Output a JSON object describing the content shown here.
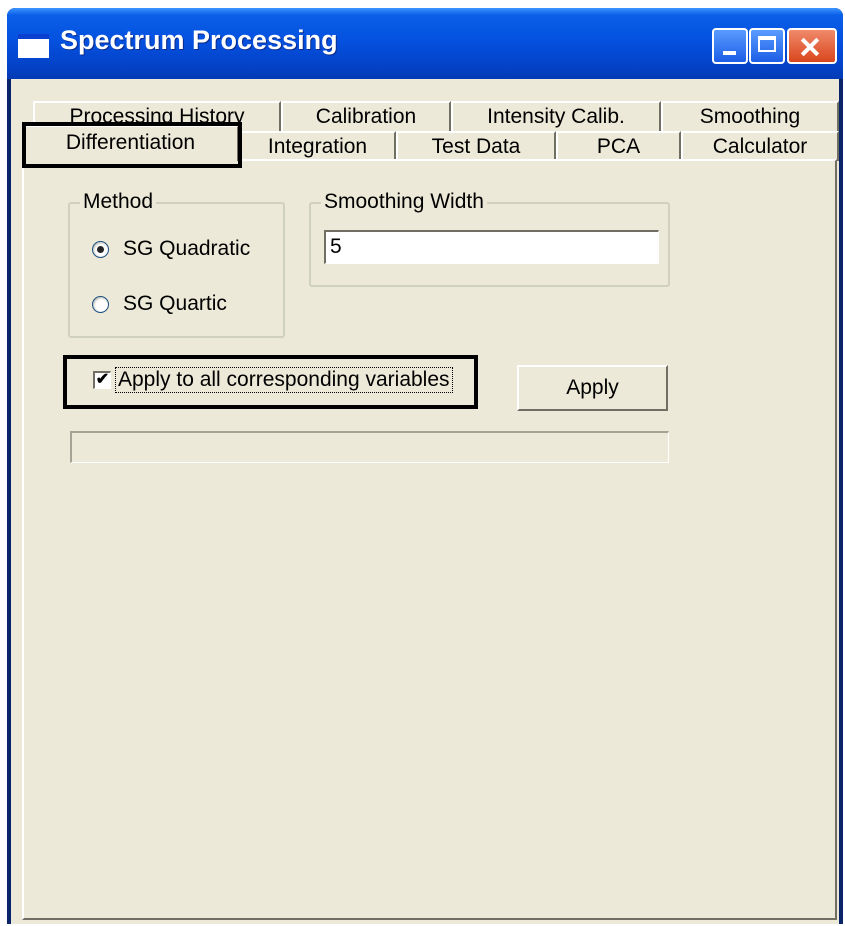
{
  "window": {
    "title": "Spectrum Processing",
    "icons": [
      "window-icon",
      "minimize-icon",
      "maximize-icon",
      "close-icon"
    ]
  },
  "tabs": {
    "row1": [
      "Processing History",
      "Calibration",
      "Intensity Calib.",
      "Smoothing"
    ],
    "row2": [
      "Differentiation",
      "Integration",
      "Test Data",
      "PCA",
      "Calculator"
    ],
    "selected": "Differentiation"
  },
  "method": {
    "label": "Method",
    "options": [
      "SG Quadratic",
      "SG Quartic"
    ],
    "selected": "SG Quadratic"
  },
  "smoothing": {
    "label": "Smoothing Width",
    "value": "5"
  },
  "apply_all": {
    "label": "Apply to all corresponding variables",
    "checked": true,
    "check_glyph": "✔"
  },
  "apply_button": {
    "label": "Apply"
  },
  "progress": {
    "value": 0
  },
  "colors": {
    "titlebar": "#0551e0",
    "dialog_bg": "#ece9d8",
    "close_button": "#d9461d"
  }
}
